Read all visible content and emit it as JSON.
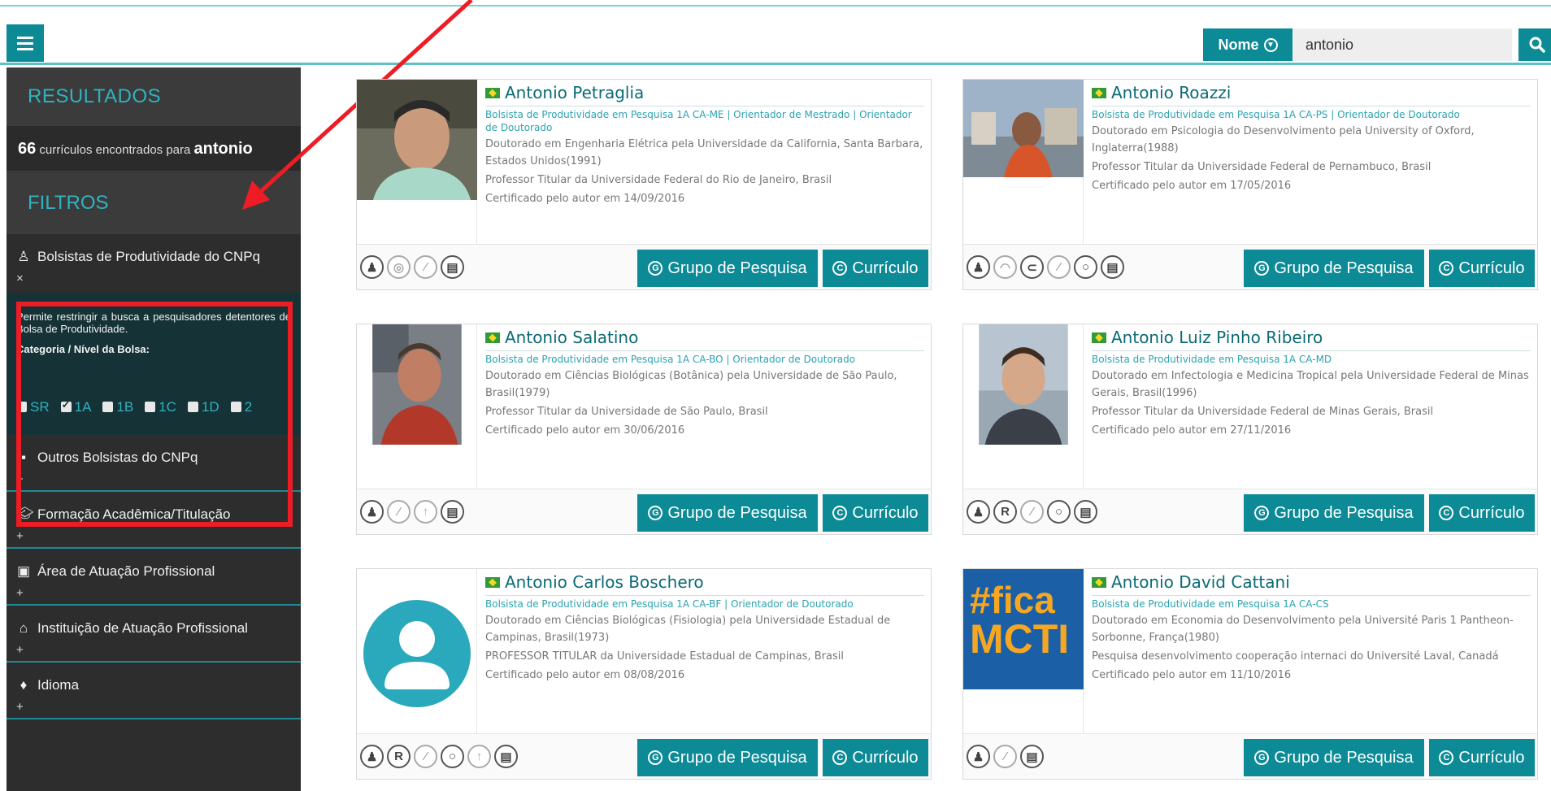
{
  "search": {
    "type_label": "Nome",
    "query": "antonio"
  },
  "sidebar": {
    "results_heading": "RESULTADOS",
    "count": "66",
    "count_text": "currículos encontrados para",
    "term": "antonio",
    "filters_heading": "FILTROS",
    "filters": [
      {
        "label": "Bolsistas de Produtividade do CNPq",
        "toggle": "×"
      },
      {
        "label": "Outros Bolsistas do CNPq",
        "toggle": "+"
      },
      {
        "label": "Formação Acadêmica/Titulação",
        "toggle": "+"
      },
      {
        "label": "Área de Atuação Profissional",
        "toggle": "+"
      },
      {
        "label": "Instituição de Atuação Profissional",
        "toggle": "+"
      },
      {
        "label": "Idioma",
        "toggle": "+"
      }
    ],
    "bolsa_desc": "Permite restringir a busca a pesquisadores detentores de Bolsa de Produtividade.",
    "bolsa_cat": "Categoria / Nível da Bolsa:",
    "levels": [
      "SR",
      "1A",
      "1B",
      "1C",
      "1D",
      "2"
    ],
    "checked_level": "1A"
  },
  "buttons": {
    "grupo": "Grupo de Pesquisa",
    "curriculo": "Currículo"
  },
  "cards": [
    {
      "name": "Antonio Petraglia",
      "bolsa": "Bolsista de Produtividade em Pesquisa 1A CA-ME | Orientador de Mestrado | Orientador de Doutorado",
      "lines": [
        "Doutorado em Engenharia Elétrica pela Universidade da California, Santa Barbara, Estados Unidos(1991)",
        "Professor Titular da Universidade Federal do Rio de Janeiro, Brasil",
        "Certificado pelo autor em 14/09/2016"
      ]
    },
    {
      "name": "Antonio Roazzi",
      "bolsa": "Bolsista de Produtividade em Pesquisa 1A CA-PS | Orientador de Doutorado",
      "lines": [
        "Doutorado em Psicologia do Desenvolvimento pela University of Oxford, Inglaterra(1988)",
        "Professor Titular da Universidade Federal de Pernambuco, Brasil",
        "Certificado pelo autor em 17/05/2016"
      ]
    },
    {
      "name": "Antonio Salatino",
      "bolsa": "Bolsista de Produtividade em Pesquisa 1A CA-BO | Orientador de Doutorado",
      "lines": [
        "Doutorado em Ciências Biológicas (Botânica) pela Universidade de São Paulo, Brasil(1979)",
        "Professor Titular da Universidade de São Paulo, Brasil",
        "Certificado pelo autor em 30/06/2016"
      ]
    },
    {
      "name": "Antonio Luiz Pinho Ribeiro",
      "bolsa": "Bolsista de Produtividade em Pesquisa 1A CA-MD",
      "lines": [
        "Doutorado em Infectologia e Medicina Tropical pela Universidade Federal de Minas Gerais, Brasil(1996)",
        "Professor Titular da Universidade Federal de Minas Gerais, Brasil",
        "Certificado pelo autor em 27/11/2016"
      ]
    },
    {
      "name": "Antonio Carlos Boschero",
      "bolsa": "Bolsista de Produtividade em Pesquisa 1A CA-BF | Orientador de Doutorado",
      "lines": [
        "Doutorado em Ciências Biológicas (Fisiologia) pela Universidade Estadual de Campinas, Brasil(1973)",
        "PROFESSOR TITULAR da Universidade Estadual de Campinas, Brasil",
        "Certificado pelo autor em 08/08/2016"
      ]
    },
    {
      "name": "Antonio David Cattani",
      "bolsa": "Bolsista de Produtividade em Pesquisa 1A CA-CS",
      "lines": [
        "Doutorado em Economia do Desenvolvimento pela Université Paris 1 Pantheon-Sorbonne, França(1980)",
        "Pesquisa desenvolvimento cooperação internaci do Université Laval, Canadá",
        "Certificado pelo autor em 11/10/2016"
      ]
    }
  ],
  "logo_text": {
    "line1": "#fica",
    "line2": "MCTI"
  },
  "colors": {
    "accent": "#0c8a96",
    "highlight": "#ee1c24",
    "sidebar": "#2d2d2d",
    "heading": "#2fb3c1"
  }
}
